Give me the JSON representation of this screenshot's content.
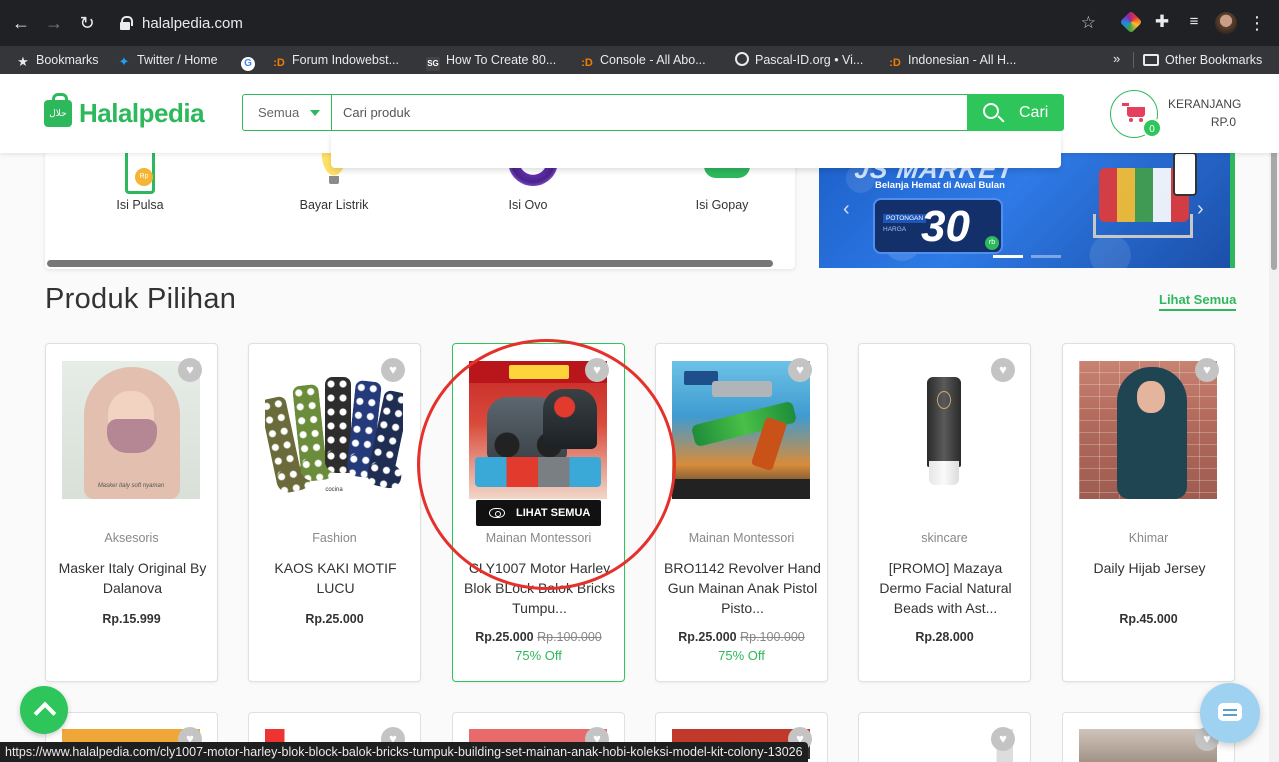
{
  "browser": {
    "url": "halalpedia.com",
    "bookmarks": [
      {
        "label": "Bookmarks",
        "icon": "star-icon"
      },
      {
        "label": "Twitter / Home",
        "icon": "twitter-icon"
      },
      {
        "label": "",
        "icon": "google-icon"
      },
      {
        "label": "Forum Indowebst...",
        "icon": "indowebster-icon"
      },
      {
        "label": "How To Create 80...",
        "icon": "sg-icon"
      },
      {
        "label": "Console - All Abo...",
        "icon": "indowebster-icon"
      },
      {
        "label": "Pascal-ID.org • Vi...",
        "icon": "globe-icon"
      },
      {
        "label": "Indonesian - All H...",
        "icon": "indowebster-icon"
      }
    ],
    "more_bookmarks": "»",
    "other_bookmarks": "Other Bookmarks",
    "status_url": "https://www.halalpedia.com/cly1007-motor-harley-blok-block-balok-bricks-tumpuk-building-set-mainan-anak-hobi-koleksi-model-kit-colony-13026"
  },
  "header": {
    "logo_text": "Halalpedia",
    "logo_badge": "حلال",
    "category": "Semua",
    "search_placeholder": "Cari produk",
    "search_button": "Cari",
    "cart_count": "0",
    "cart_label": "KERANJANG",
    "cart_total": "RP.0"
  },
  "services": [
    {
      "label": "Isi Pulsa",
      "badge": "Rp"
    },
    {
      "label": "Bayar Listrik"
    },
    {
      "label": "Isi Ovo"
    },
    {
      "label": "Isi Gopay"
    }
  ],
  "banner": {
    "headline": "JS MARKET",
    "subtitle": "Belanja Hemat di Awal Bulan",
    "potongan": "POTONGAN",
    "harga": "HARGA",
    "amount": "30",
    "unit": "rb"
  },
  "section": {
    "title": "Produk Pilihan",
    "see_all": "Lihat Semua"
  },
  "overlay": {
    "label": "LIHAT SEMUA"
  },
  "products": [
    {
      "category": "Aksesoris",
      "name": "Masker Italy Original By Dalanova",
      "price": "Rp.15.999",
      "old_price": "",
      "discount": "",
      "img_caption": "Masker italy soft nyaman"
    },
    {
      "category": "Fashion",
      "name": "KAOS KAKI MOTIF LUCU",
      "price": "Rp.25.000",
      "old_price": "",
      "discount": "",
      "img_caption": "cocina"
    },
    {
      "category": "Mainan Montessori",
      "name": "CLY1007 Motor Harley Blok BLock Balok Bricks Tumpu...",
      "price": "Rp.25.000",
      "old_price": "Rp.100.000",
      "discount": "75% Off"
    },
    {
      "category": "Mainan Montessori",
      "name": "BRO1142 Revolver Hand Gun Mainan Anak Pistol Pisto...",
      "price": "Rp.25.000",
      "old_price": "Rp.100.000",
      "discount": "75% Off"
    },
    {
      "category": "skincare",
      "name": "[PROMO] Mazaya Dermo Facial Natural Beads with Ast...",
      "price": "Rp.28.000",
      "old_price": "",
      "discount": ""
    },
    {
      "category": "Khimar",
      "name": "Daily Hijab Jersey",
      "price": "Rp.45.000",
      "old_price": "",
      "discount": ""
    }
  ],
  "colors": {
    "brand": "#2eb85c",
    "button": "#2ec65a",
    "annotation": "#e5312b"
  }
}
